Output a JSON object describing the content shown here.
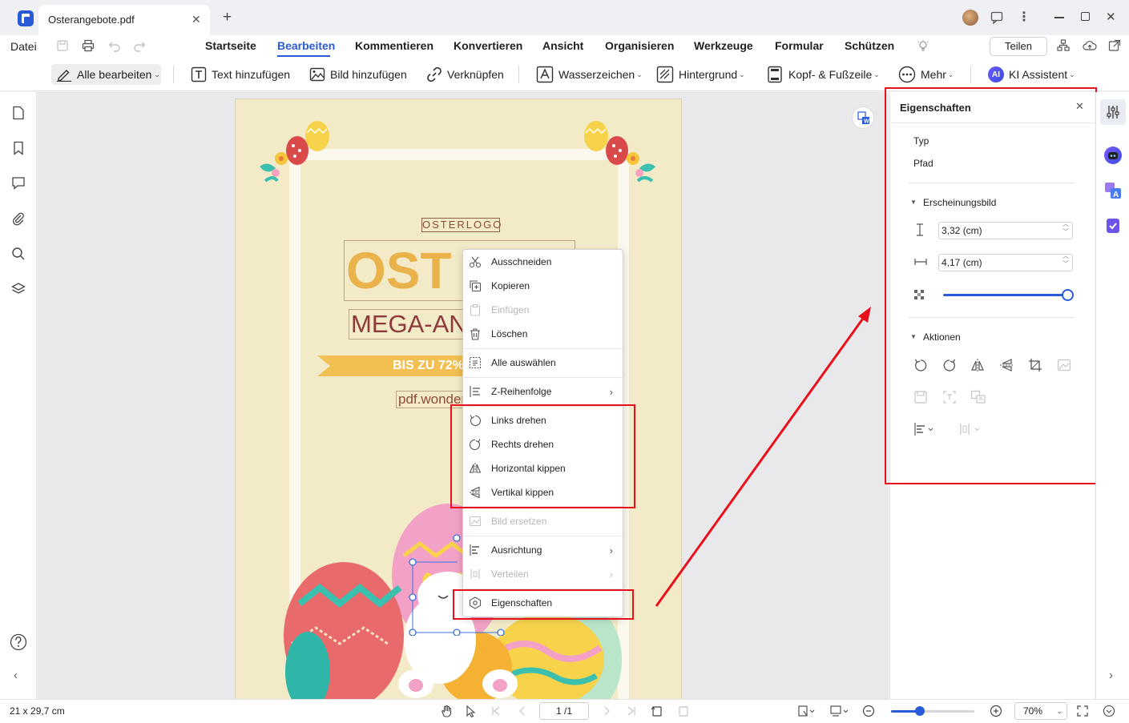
{
  "titlebar": {
    "tab_title": "Osterangebote.pdf",
    "new_tab": "+"
  },
  "menubar": {
    "file": "Datei",
    "tabs": [
      "Startseite",
      "Bearbeiten",
      "Kommentieren",
      "Konvertieren",
      "Ansicht",
      "Organisieren",
      "Werkzeuge",
      "Formular",
      "Schützen"
    ],
    "active_tab": "Bearbeiten",
    "share": "Teilen"
  },
  "toolbar": {
    "edit_all": "Alle bearbeiten",
    "add_text": "Text hinzufügen",
    "add_image": "Bild hinzufügen",
    "link": "Verknüpfen",
    "watermark": "Wasserzeichen",
    "background": "Hintergrund",
    "header_footer": "Kopf- & Fußzeile",
    "more": "Mehr",
    "ai_badge": "AI",
    "ai_assistant": "KI Assistent"
  },
  "document": {
    "logo_text": "OSTERLOGO",
    "headline_partial": "OST",
    "sub_partial": "MEGA-AN",
    "banner_partial": "BIS ZU 72%",
    "url_partial": "pdf.wonder"
  },
  "context_menu": {
    "items": [
      {
        "label": "Ausschneiden",
        "icon": "scissors-icon",
        "enabled": true
      },
      {
        "label": "Kopieren",
        "icon": "copy-icon",
        "enabled": true
      },
      {
        "label": "Einfügen",
        "icon": "paste-icon",
        "enabled": false
      },
      {
        "label": "Löschen",
        "icon": "trash-icon",
        "enabled": true
      },
      {
        "label": "Alle auswählen",
        "icon": "select-all-icon",
        "enabled": true
      },
      {
        "label": "Z-Reihenfolge",
        "icon": "z-order-icon",
        "enabled": true
      },
      {
        "label": "Links drehen",
        "icon": "rotate-left-icon",
        "enabled": true
      },
      {
        "label": "Rechts drehen",
        "icon": "rotate-right-icon",
        "enabled": true
      },
      {
        "label": "Horizontal kippen",
        "icon": "flip-horizontal-icon",
        "enabled": true
      },
      {
        "label": "Vertikal kippen",
        "icon": "flip-vertical-icon",
        "enabled": true
      },
      {
        "label": "Bild ersetzen",
        "icon": "replace-image-icon",
        "enabled": false
      },
      {
        "label": "Ausrichtung",
        "icon": "align-icon",
        "enabled": true
      },
      {
        "label": "Verteilen",
        "icon": "distribute-icon",
        "enabled": false
      },
      {
        "label": "Eigenschaften",
        "icon": "properties-icon",
        "enabled": true
      }
    ],
    "submenu_arrow": "›"
  },
  "properties": {
    "title": "Eigenschaften",
    "type_label": "Typ",
    "type_value": "Pfad",
    "appearance": "Erscheinungsbild",
    "height": "3,32 (cm)",
    "width": "4,17 (cm)",
    "opacity": 1.0,
    "actions": "Aktionen"
  },
  "status": {
    "page_size": "21 x 29,7 cm",
    "page_indicator": "1 /1",
    "zoom": "70%",
    "zoom_slider": 0.35
  },
  "colors": {
    "accent": "#2a5bd7",
    "highlight": "#e8101a",
    "page_bg": "#f3ebc8"
  }
}
